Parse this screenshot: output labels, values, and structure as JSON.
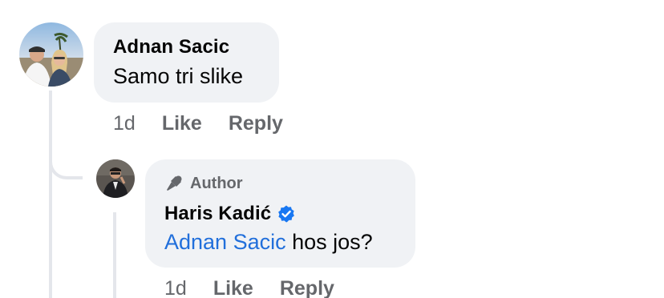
{
  "comments": [
    {
      "author": "Adnan Sacic",
      "text": "Samo tri slike",
      "time": "1d",
      "like_label": "Like",
      "reply_label": "Reply"
    }
  ],
  "reply": {
    "badge_label": "Author",
    "author": "Haris Kadić",
    "verified_icon": "verified-badge-icon",
    "mention": "Adnan Sacic",
    "text": " hos jos?",
    "time": "1d",
    "like_label": "Like",
    "reply_label": "Reply"
  },
  "colors": {
    "bubble": "#f0f2f5",
    "secondary_text": "#65676b",
    "mention": "#216fdb",
    "verified": "#1877f2",
    "thread_line": "#e4e6eb"
  }
}
